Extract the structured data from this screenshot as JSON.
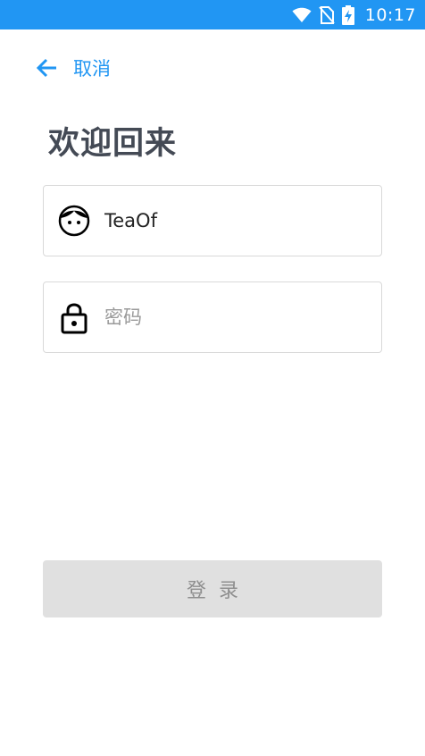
{
  "status_bar": {
    "time": "10:17",
    "icons": [
      "wifi-icon",
      "no-sim-icon",
      "battery-charging-icon"
    ],
    "background": "#2196F3"
  },
  "nav": {
    "back_label": "取消",
    "accent": "#2196F3"
  },
  "title": "欢迎回来",
  "form": {
    "username": {
      "value": "TeaOf",
      "placeholder": "",
      "icon": "face-icon"
    },
    "password": {
      "value": "",
      "placeholder": "密码",
      "icon": "lock-icon"
    }
  },
  "login_button": {
    "label": "登录",
    "background": "#e0e0e0",
    "text_color": "#8f8f8f"
  }
}
